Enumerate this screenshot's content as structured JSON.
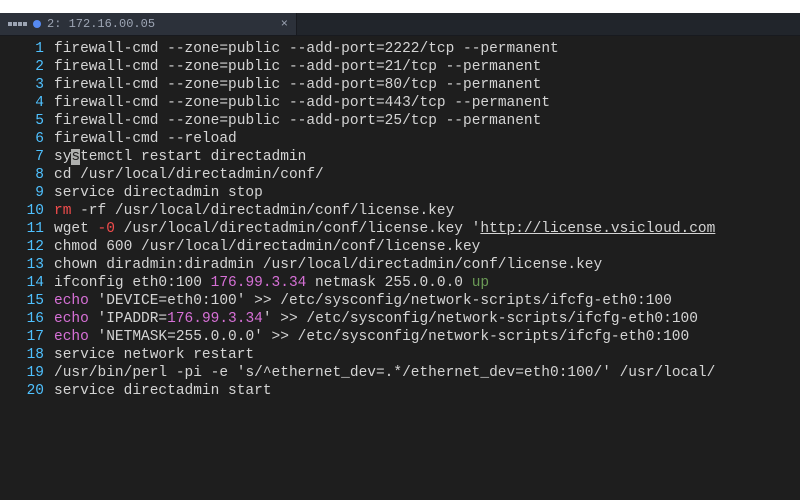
{
  "tab": {
    "prefix_icon": "dot",
    "label": "2: 172.16.00.05",
    "close_glyph": "×"
  },
  "lines": [
    {
      "n": "1",
      "tokens": [
        [
          "cmd",
          "firewall-cmd "
        ],
        [
          "opt",
          "--zone"
        ],
        [
          "cmd",
          "=public "
        ],
        [
          "opt",
          "--add-port"
        ],
        [
          "cmd",
          "=2222/tcp "
        ],
        [
          "opt",
          "--permanent"
        ]
      ]
    },
    {
      "n": "2",
      "tokens": [
        [
          "cmd",
          "firewall-cmd "
        ],
        [
          "opt",
          "--zone"
        ],
        [
          "cmd",
          "=public "
        ],
        [
          "opt",
          "--add-port"
        ],
        [
          "cmd",
          "=21/tcp "
        ],
        [
          "opt",
          "--permanent"
        ]
      ]
    },
    {
      "n": "3",
      "tokens": [
        [
          "cmd",
          "firewall-cmd "
        ],
        [
          "opt",
          "--zone"
        ],
        [
          "cmd",
          "=public "
        ],
        [
          "opt",
          "--add-port"
        ],
        [
          "cmd",
          "=80/tcp "
        ],
        [
          "opt",
          "--permanent"
        ]
      ]
    },
    {
      "n": "4",
      "tokens": [
        [
          "cmd",
          "firewall-cmd "
        ],
        [
          "opt",
          "--zone"
        ],
        [
          "cmd",
          "=public "
        ],
        [
          "opt",
          "--add-port"
        ],
        [
          "cmd",
          "=443/tcp "
        ],
        [
          "opt",
          "--permanent"
        ]
      ]
    },
    {
      "n": "5",
      "tokens": [
        [
          "cmd",
          "firewall-cmd "
        ],
        [
          "opt",
          "--zone"
        ],
        [
          "cmd",
          "=public "
        ],
        [
          "opt",
          "--add-port"
        ],
        [
          "cmd",
          "=25/tcp "
        ],
        [
          "opt",
          "--permanent"
        ]
      ]
    },
    {
      "n": "6",
      "tokens": [
        [
          "cmd",
          "firewall-cmd "
        ],
        [
          "opt",
          "--reload"
        ]
      ]
    },
    {
      "n": "7",
      "tokens": [
        [
          "cmd",
          "sy"
        ],
        [
          "cursor",
          "s"
        ],
        [
          "cmd",
          "temctl restart directadmin"
        ]
      ]
    },
    {
      "n": "8",
      "tokens": [
        [
          "cmd",
          "cd /usr/local/directadmin/conf/"
        ]
      ]
    },
    {
      "n": "9",
      "tokens": [
        [
          "cmd",
          "service directadmin stop"
        ]
      ]
    },
    {
      "n": "10",
      "tokens": [
        [
          "kwRed",
          "rm "
        ],
        [
          "opt",
          "-rf"
        ],
        [
          "cmd",
          " /usr/local/directadmin/conf/license.key"
        ]
      ]
    },
    {
      "n": "11",
      "tokens": [
        [
          "cmd",
          "wget "
        ],
        [
          "kwRed",
          "-0"
        ],
        [
          "cmd",
          " /usr/local/directadmin/conf/license.key '"
        ],
        [
          "url",
          "http://license.vsicloud.com"
        ]
      ]
    },
    {
      "n": "12",
      "tokens": [
        [
          "cmd",
          "chmod 600 /usr/local/directadmin/conf/license.key"
        ]
      ]
    },
    {
      "n": "13",
      "tokens": [
        [
          "cmd",
          "chown diradmin:diradmin /usr/local/directadmin/conf/license.key"
        ]
      ]
    },
    {
      "n": "14",
      "tokens": [
        [
          "cmd",
          "ifconfig eth0:100 "
        ],
        [
          "num",
          "176.99.3.34"
        ],
        [
          "cmd",
          " netmask 255.0.0.0 "
        ],
        [
          "kwGrn",
          "up"
        ]
      ]
    },
    {
      "n": "15",
      "tokens": [
        [
          "kwMag",
          "echo"
        ],
        [
          "cmd",
          " 'DEVICE=eth0:100' >> /etc/sysconfig/network-scripts/ifcfg-eth0:100"
        ]
      ]
    },
    {
      "n": "16",
      "tokens": [
        [
          "kwMag",
          "echo"
        ],
        [
          "cmd",
          " 'IPADDR="
        ],
        [
          "num",
          "176.99.3.34"
        ],
        [
          "cmd",
          "' >> /etc/sysconfig/network-scripts/ifcfg-eth0:100"
        ]
      ]
    },
    {
      "n": "17",
      "tokens": [
        [
          "kwMag",
          "echo"
        ],
        [
          "cmd",
          " 'NETMASK=255.0.0.0' >> /etc/sysconfig/network-scripts/ifcfg-eth0:100"
        ]
      ]
    },
    {
      "n": "18",
      "tokens": [
        [
          "cmd",
          "service network restart"
        ]
      ]
    },
    {
      "n": "19",
      "tokens": [
        [
          "cmd",
          "/usr/bin/perl "
        ],
        [
          "opt",
          "-pi"
        ],
        [
          "cmd",
          " "
        ],
        [
          "opt",
          "-e"
        ],
        [
          "cmd",
          " 's/^ethernet_dev=.*/ethernet_dev=eth0:100/' /usr/local/"
        ]
      ]
    },
    {
      "n": "20",
      "tokens": [
        [
          "cmd",
          "service directadmin start"
        ]
      ]
    }
  ]
}
